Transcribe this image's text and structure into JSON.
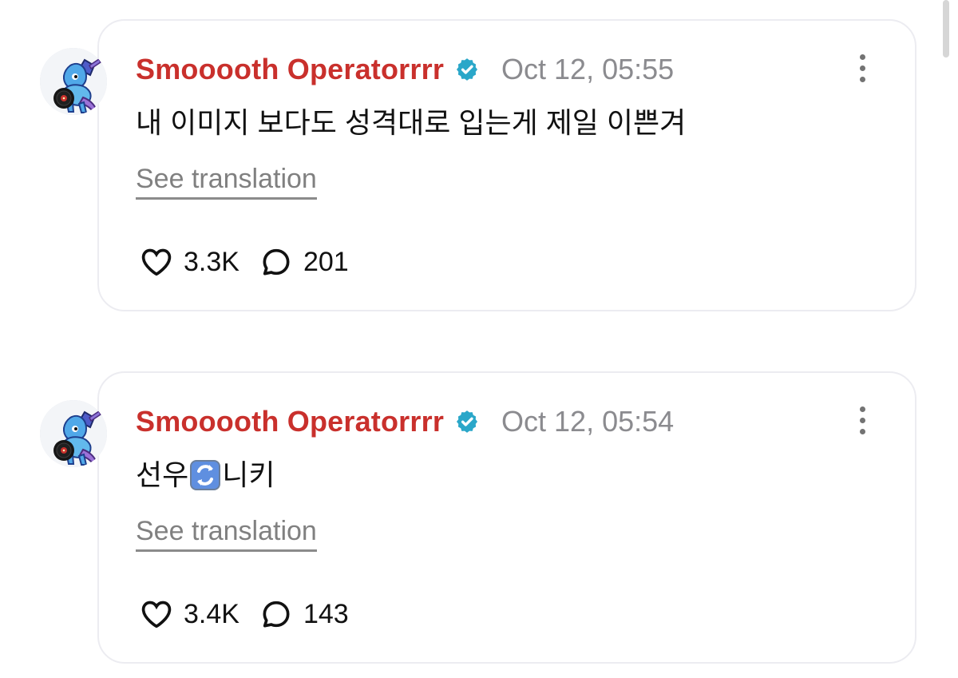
{
  "posts": [
    {
      "username": "Smooooth Operatorrrr",
      "timestamp": "Oct 12, 05:55",
      "text": "내 이미지 보다도 성격대로 입는게 제일 이쁜겨",
      "translation_link": "See translation",
      "likes": "3.3K",
      "comments": "201",
      "avatar_icon": "mascot-avatar-icon",
      "verified_icon": "verified-icon"
    },
    {
      "username": "Smooooth Operatorrrr",
      "timestamp": "Oct 12, 05:54",
      "text_before": "선우",
      "text_emoji": "repeat-emoji",
      "text_after": "니키",
      "translation_link": "See translation",
      "likes": "3.4K",
      "comments": "143",
      "avatar_icon": "mascot-avatar-icon",
      "verified_icon": "verified-icon"
    }
  ],
  "colors": {
    "username": "#c9302c",
    "verified": "#2aa7c9",
    "timestamp": "#8b8b8f",
    "link": "#808080",
    "card_border": "#ececf1"
  }
}
